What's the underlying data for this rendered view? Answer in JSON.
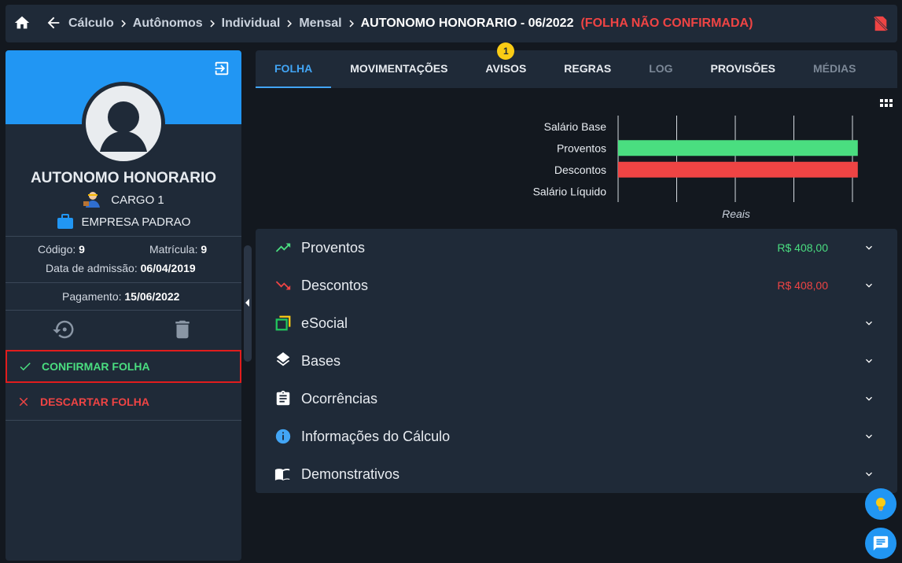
{
  "topbar": {
    "breadcrumb": [
      "Cálculo",
      "Autônomos",
      "Individual",
      "Mensal"
    ],
    "current": "AUTONOMO HONORARIO - 06/2022",
    "status": "(FOLHA NÃO CONFIRMADA)",
    "status_color": "#ef4444"
  },
  "profile": {
    "name": "AUTONOMO HONORARIO",
    "cargo": "CARGO 1",
    "empresa": "EMPRESA PADRAO",
    "codigo_label": "Código:",
    "codigo": "9",
    "matricula_label": "Matrícula:",
    "matricula": "9",
    "admissao_label": "Data de admissão:",
    "admissao": "06/04/2019",
    "pagamento_label": "Pagamento:",
    "pagamento": "15/06/2022",
    "banner_color": "#2196f3"
  },
  "commands": {
    "confirm": "CONFIRMAR FOLHA",
    "discard": "DESCARTAR FOLHA"
  },
  "tabs": [
    {
      "label": "FOLHA",
      "state": "active"
    },
    {
      "label": "MOVIMENTAÇÕES",
      "state": "normal"
    },
    {
      "label": "AVISOS",
      "state": "normal",
      "badge": "1"
    },
    {
      "label": "REGRAS",
      "state": "normal"
    },
    {
      "label": "LOG",
      "state": "muted"
    },
    {
      "label": "PROVISÕES",
      "state": "normal"
    },
    {
      "label": "MÉDIAS",
      "state": "muted"
    }
  ],
  "chart_data": {
    "type": "bar",
    "orientation": "horizontal",
    "categories": [
      "Salário Base",
      "Proventos",
      "Descontos",
      "Salário Líquido"
    ],
    "values": [
      0,
      408,
      408,
      0
    ],
    "colors": [
      "#4ade80",
      "#4ade80",
      "#ef4444",
      "#ef4444"
    ],
    "xlabel": "Reais",
    "xlim": [
      0,
      500
    ],
    "grid": true
  },
  "accordion": [
    {
      "label": "Proventos",
      "icon": "trending-up-icon",
      "value": "R$ 408,00",
      "value_color": "#4ade80"
    },
    {
      "label": "Descontos",
      "icon": "trending-down-icon",
      "value": "R$ 408,00",
      "value_color": "#ef4444"
    },
    {
      "label": "eSocial",
      "icon": "esocial-icon",
      "value": ""
    },
    {
      "label": "Bases",
      "icon": "layers-icon",
      "value": ""
    },
    {
      "label": "Ocorrências",
      "icon": "clipboard-icon",
      "value": ""
    },
    {
      "label": "Informações do Cálculo",
      "icon": "info-icon",
      "value": ""
    },
    {
      "label": "Demonstrativos",
      "icon": "book-icon",
      "value": ""
    }
  ]
}
